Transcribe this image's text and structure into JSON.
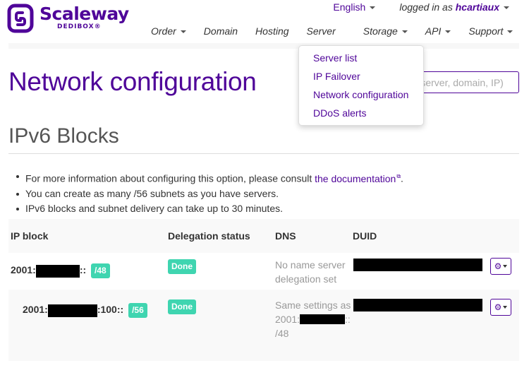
{
  "brand": {
    "name": "Scaleway",
    "sub": "DEDIBOX®",
    "color": "#4f0599"
  },
  "topbar": {
    "language": "English",
    "logged_in_prefix": "logged in as ",
    "username": "hcartiaux"
  },
  "nav": [
    {
      "label": "Order",
      "has_caret": true
    },
    {
      "label": "Domain",
      "has_caret": false
    },
    {
      "label": "Hosting",
      "has_caret": false
    },
    {
      "label": "Server",
      "has_caret": false
    },
    {
      "label": "Storage",
      "has_caret": true
    },
    {
      "label": "API",
      "has_caret": true
    },
    {
      "label": "Support",
      "has_caret": true
    }
  ],
  "server_dropdown": {
    "items": [
      "Server list",
      "IP Failover",
      "Network configuration",
      "DDoS alerts"
    ]
  },
  "page": {
    "title": "Network configuration",
    "search_placeholder": "(server, domain, IP...)"
  },
  "section": {
    "title": "IPv6 Blocks",
    "info": {
      "line1_prefix": "For more information about configuring this option, please consult ",
      "line1_link": "the documentation",
      "line1_suffix": ".",
      "line2": "You can create as many /56 subnets as you have servers.",
      "line3": "IPv6 blocks and subnet delivery can take up to 30 minutes."
    }
  },
  "table": {
    "headers": {
      "ip": "IP block",
      "delegation": "Delegation status",
      "dns": "DNS",
      "duid": "DUID"
    },
    "rows": [
      {
        "ip_prefix": "2001:",
        "ip_suffix": "::",
        "prefix_len": "/48",
        "status": "Done",
        "dns_text": "No name server delegation set"
      },
      {
        "ip_prefix": "2001:",
        "ip_suffix": ":100::",
        "prefix_len": "/56",
        "status": "Done",
        "dns_line1": "Same settings as",
        "dns_ip_prefix": "2001:",
        "dns_ip_suffix": "::",
        "dns_ip_len": "/48"
      }
    ]
  },
  "colors": {
    "accent": "#4f0599",
    "success": "#3fd5b0",
    "row_alt": "#f9f9f9"
  }
}
